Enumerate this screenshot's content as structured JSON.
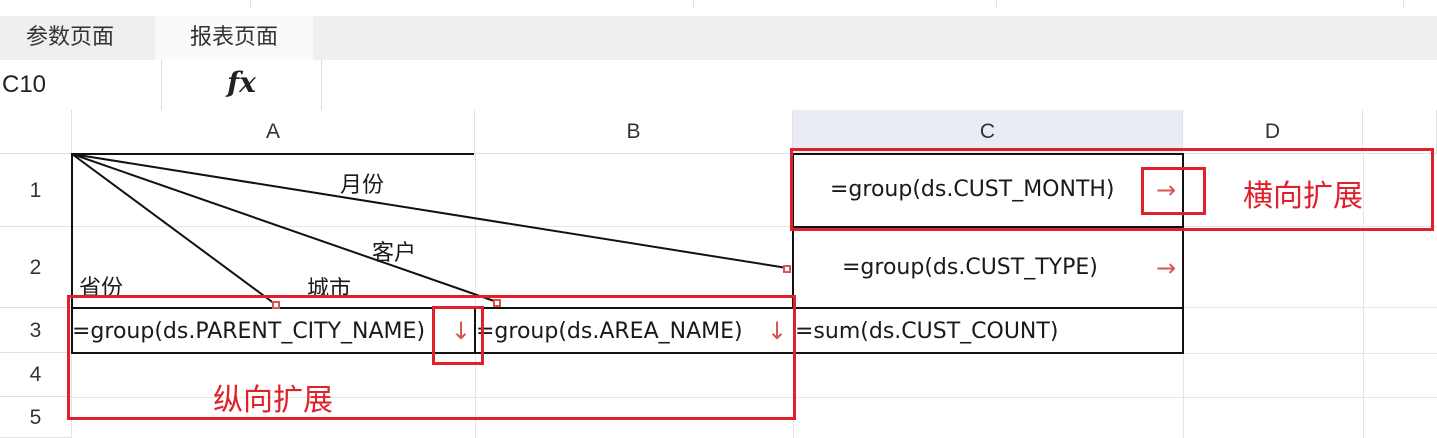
{
  "tabs": [
    {
      "label": "参数页面",
      "active": false
    },
    {
      "label": "报表页面",
      "active": true
    }
  ],
  "formula_bar": {
    "cell_ref": "C10",
    "fx_label": "fx",
    "formula": ""
  },
  "columns": [
    "A",
    "B",
    "C",
    "D"
  ],
  "rows": [
    "1",
    "2",
    "3",
    "4",
    "5"
  ],
  "cells": {
    "header_month": "月份",
    "header_customer": "客户",
    "header_province": "省份",
    "header_city": "城市",
    "c1": "=group(ds.CUST_MONTH)",
    "c2": "=group(ds.CUST_TYPE)",
    "a3": "=group(ds.PARENT_CITY_NAME)",
    "b3": "=group(ds.AREA_NAME)",
    "c3": "=sum(ds.CUST_COUNT)"
  },
  "annotations": {
    "horizontal": "横向扩展",
    "vertical": "纵向扩展"
  },
  "glyphs": {
    "right_arrow": "→",
    "down_arrow": "↓"
  },
  "colors": {
    "annotation_red": "#e0202b",
    "arrow_red": "#d9534f",
    "selected_header": "#e9edf3"
  }
}
